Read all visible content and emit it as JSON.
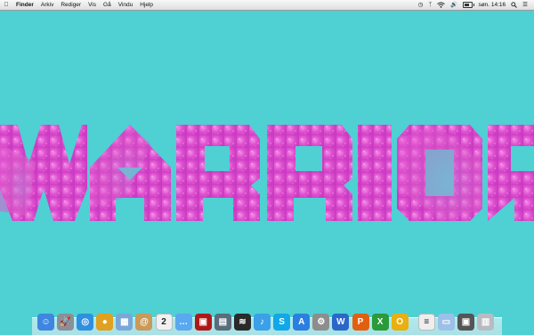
{
  "menubar": {
    "apple_icon": "apple-logo-icon",
    "items": [
      "Finder",
      "Arkiv",
      "Rediger",
      "Vis",
      "Gå",
      "Vindu",
      "Hjelp"
    ],
    "status": {
      "clock": "søn. 14:16",
      "icons": [
        "time-machine-icon",
        "bluetooth-icon",
        "wifi-icon",
        "volume-icon",
        "battery-icon",
        "spotlight-icon",
        "notification-center-icon"
      ]
    }
  },
  "wallpaper": {
    "background_color": "#4fd0d3",
    "word": "WARRIOR",
    "letter_color": "#e356d2"
  },
  "dock": {
    "apps": [
      {
        "name": "finder-icon",
        "glyph": "☺",
        "color": "#3e86e0"
      },
      {
        "name": "launchpad-icon",
        "glyph": "🚀",
        "color": "#8a8f99"
      },
      {
        "name": "safari-icon",
        "glyph": "◎",
        "color": "#2f8fe0"
      },
      {
        "name": "chrome-icon",
        "glyph": "●",
        "color": "#e0a020"
      },
      {
        "name": "preview-icon",
        "glyph": "▦",
        "color": "#7aa7d8"
      },
      {
        "name": "contacts-icon",
        "glyph": "@",
        "color": "#c99a5a"
      },
      {
        "name": "calendar-icon",
        "glyph": "2",
        "color": "#f1f1f1"
      },
      {
        "name": "messages-icon",
        "glyph": "…",
        "color": "#5aa8f0"
      },
      {
        "name": "photo-booth-icon",
        "glyph": "▣",
        "color": "#b01818"
      },
      {
        "name": "iphoto-icon",
        "glyph": "▤",
        "color": "#5b6c7a"
      },
      {
        "name": "spotify-icon",
        "glyph": "≋",
        "color": "#2a2a2a"
      },
      {
        "name": "itunes-icon",
        "glyph": "♪",
        "color": "#3aa0e8"
      },
      {
        "name": "skype-icon",
        "glyph": "S",
        "color": "#10a8e8"
      },
      {
        "name": "app-store-icon",
        "glyph": "A",
        "color": "#2b7fe0"
      },
      {
        "name": "system-preferences-icon",
        "glyph": "⚙",
        "color": "#8d8d8d"
      },
      {
        "name": "word-icon",
        "glyph": "W",
        "color": "#2b67c8"
      },
      {
        "name": "powerpoint-icon",
        "glyph": "P",
        "color": "#e06010"
      },
      {
        "name": "excel-icon",
        "glyph": "X",
        "color": "#2a9a3a"
      },
      {
        "name": "outlook-icon",
        "glyph": "O",
        "color": "#e8b010"
      }
    ],
    "stacks": [
      {
        "name": "document-stack-icon",
        "glyph": "≡",
        "color": "#eeeeee"
      },
      {
        "name": "applications-folder-icon",
        "glyph": "▭",
        "color": "#9cc0e8"
      },
      {
        "name": "downloads-stack-icon",
        "glyph": "▣",
        "color": "#555555"
      },
      {
        "name": "trash-icon",
        "glyph": "▥",
        "color": "#b8bcc0"
      }
    ]
  }
}
